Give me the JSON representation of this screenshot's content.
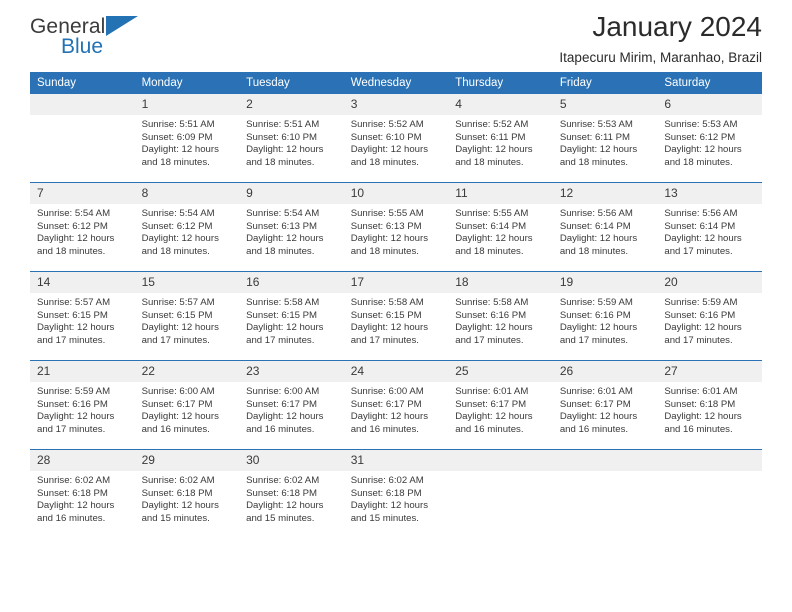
{
  "brand": {
    "name_top": "General",
    "name_bottom": "Blue",
    "accent_color": "#2272b4"
  },
  "header": {
    "title": "January 2024",
    "subtitle": "Itapecuru Mirim, Maranhao, Brazil"
  },
  "theme": {
    "header_blue": "#2a72b5",
    "day_band_gray": "#f0f0f0",
    "text": "#3a3a3a"
  },
  "labels": {
    "sunrise_prefix": "Sunrise:",
    "sunset_prefix": "Sunset:",
    "daylight_prefix": "Daylight:"
  },
  "weekdays": [
    "Sunday",
    "Monday",
    "Tuesday",
    "Wednesday",
    "Thursday",
    "Friday",
    "Saturday"
  ],
  "weeks": [
    [
      {
        "day": "",
        "sunrise": "",
        "sunset": "",
        "daylight": "",
        "empty": true
      },
      {
        "day": "1",
        "sunrise": "Sunrise: 5:51 AM",
        "sunset": "Sunset: 6:09 PM",
        "daylight": "Daylight: 12 hours and 18 minutes."
      },
      {
        "day": "2",
        "sunrise": "Sunrise: 5:51 AM",
        "sunset": "Sunset: 6:10 PM",
        "daylight": "Daylight: 12 hours and 18 minutes."
      },
      {
        "day": "3",
        "sunrise": "Sunrise: 5:52 AM",
        "sunset": "Sunset: 6:10 PM",
        "daylight": "Daylight: 12 hours and 18 minutes."
      },
      {
        "day": "4",
        "sunrise": "Sunrise: 5:52 AM",
        "sunset": "Sunset: 6:11 PM",
        "daylight": "Daylight: 12 hours and 18 minutes."
      },
      {
        "day": "5",
        "sunrise": "Sunrise: 5:53 AM",
        "sunset": "Sunset: 6:11 PM",
        "daylight": "Daylight: 12 hours and 18 minutes."
      },
      {
        "day": "6",
        "sunrise": "Sunrise: 5:53 AM",
        "sunset": "Sunset: 6:12 PM",
        "daylight": "Daylight: 12 hours and 18 minutes."
      }
    ],
    [
      {
        "day": "7",
        "sunrise": "Sunrise: 5:54 AM",
        "sunset": "Sunset: 6:12 PM",
        "daylight": "Daylight: 12 hours and 18 minutes."
      },
      {
        "day": "8",
        "sunrise": "Sunrise: 5:54 AM",
        "sunset": "Sunset: 6:12 PM",
        "daylight": "Daylight: 12 hours and 18 minutes."
      },
      {
        "day": "9",
        "sunrise": "Sunrise: 5:54 AM",
        "sunset": "Sunset: 6:13 PM",
        "daylight": "Daylight: 12 hours and 18 minutes."
      },
      {
        "day": "10",
        "sunrise": "Sunrise: 5:55 AM",
        "sunset": "Sunset: 6:13 PM",
        "daylight": "Daylight: 12 hours and 18 minutes."
      },
      {
        "day": "11",
        "sunrise": "Sunrise: 5:55 AM",
        "sunset": "Sunset: 6:14 PM",
        "daylight": "Daylight: 12 hours and 18 minutes."
      },
      {
        "day": "12",
        "sunrise": "Sunrise: 5:56 AM",
        "sunset": "Sunset: 6:14 PM",
        "daylight": "Daylight: 12 hours and 18 minutes."
      },
      {
        "day": "13",
        "sunrise": "Sunrise: 5:56 AM",
        "sunset": "Sunset: 6:14 PM",
        "daylight": "Daylight: 12 hours and 17 minutes."
      }
    ],
    [
      {
        "day": "14",
        "sunrise": "Sunrise: 5:57 AM",
        "sunset": "Sunset: 6:15 PM",
        "daylight": "Daylight: 12 hours and 17 minutes."
      },
      {
        "day": "15",
        "sunrise": "Sunrise: 5:57 AM",
        "sunset": "Sunset: 6:15 PM",
        "daylight": "Daylight: 12 hours and 17 minutes."
      },
      {
        "day": "16",
        "sunrise": "Sunrise: 5:58 AM",
        "sunset": "Sunset: 6:15 PM",
        "daylight": "Daylight: 12 hours and 17 minutes."
      },
      {
        "day": "17",
        "sunrise": "Sunrise: 5:58 AM",
        "sunset": "Sunset: 6:15 PM",
        "daylight": "Daylight: 12 hours and 17 minutes."
      },
      {
        "day": "18",
        "sunrise": "Sunrise: 5:58 AM",
        "sunset": "Sunset: 6:16 PM",
        "daylight": "Daylight: 12 hours and 17 minutes."
      },
      {
        "day": "19",
        "sunrise": "Sunrise: 5:59 AM",
        "sunset": "Sunset: 6:16 PM",
        "daylight": "Daylight: 12 hours and 17 minutes."
      },
      {
        "day": "20",
        "sunrise": "Sunrise: 5:59 AM",
        "sunset": "Sunset: 6:16 PM",
        "daylight": "Daylight: 12 hours and 17 minutes."
      }
    ],
    [
      {
        "day": "21",
        "sunrise": "Sunrise: 5:59 AM",
        "sunset": "Sunset: 6:16 PM",
        "daylight": "Daylight: 12 hours and 17 minutes."
      },
      {
        "day": "22",
        "sunrise": "Sunrise: 6:00 AM",
        "sunset": "Sunset: 6:17 PM",
        "daylight": "Daylight: 12 hours and 16 minutes."
      },
      {
        "day": "23",
        "sunrise": "Sunrise: 6:00 AM",
        "sunset": "Sunset: 6:17 PM",
        "daylight": "Daylight: 12 hours and 16 minutes."
      },
      {
        "day": "24",
        "sunrise": "Sunrise: 6:00 AM",
        "sunset": "Sunset: 6:17 PM",
        "daylight": "Daylight: 12 hours and 16 minutes."
      },
      {
        "day": "25",
        "sunrise": "Sunrise: 6:01 AM",
        "sunset": "Sunset: 6:17 PM",
        "daylight": "Daylight: 12 hours and 16 minutes."
      },
      {
        "day": "26",
        "sunrise": "Sunrise: 6:01 AM",
        "sunset": "Sunset: 6:17 PM",
        "daylight": "Daylight: 12 hours and 16 minutes."
      },
      {
        "day": "27",
        "sunrise": "Sunrise: 6:01 AM",
        "sunset": "Sunset: 6:18 PM",
        "daylight": "Daylight: 12 hours and 16 minutes."
      }
    ],
    [
      {
        "day": "28",
        "sunrise": "Sunrise: 6:02 AM",
        "sunset": "Sunset: 6:18 PM",
        "daylight": "Daylight: 12 hours and 16 minutes."
      },
      {
        "day": "29",
        "sunrise": "Sunrise: 6:02 AM",
        "sunset": "Sunset: 6:18 PM",
        "daylight": "Daylight: 12 hours and 15 minutes."
      },
      {
        "day": "30",
        "sunrise": "Sunrise: 6:02 AM",
        "sunset": "Sunset: 6:18 PM",
        "daylight": "Daylight: 12 hours and 15 minutes."
      },
      {
        "day": "31",
        "sunrise": "Sunrise: 6:02 AM",
        "sunset": "Sunset: 6:18 PM",
        "daylight": "Daylight: 12 hours and 15 minutes."
      },
      {
        "day": "",
        "sunrise": "",
        "sunset": "",
        "daylight": "",
        "empty": true
      },
      {
        "day": "",
        "sunrise": "",
        "sunset": "",
        "daylight": "",
        "empty": true
      },
      {
        "day": "",
        "sunrise": "",
        "sunset": "",
        "daylight": "",
        "empty": true
      }
    ]
  ]
}
